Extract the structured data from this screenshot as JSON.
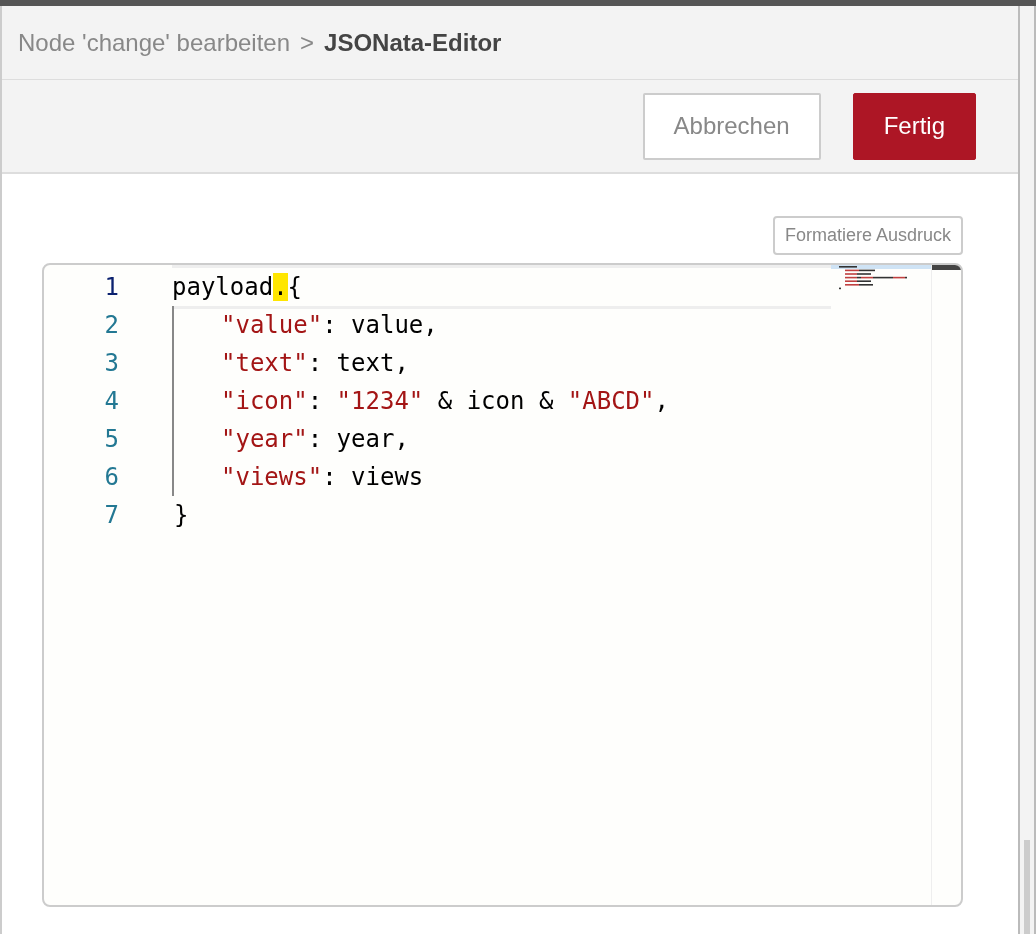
{
  "breadcrumb": {
    "parent": "Node 'change' bearbeiten",
    "separator": ">",
    "current": "JSONata-Editor"
  },
  "buttons": [
    {
      "label": "Abbrechen",
      "kind": "secondary"
    },
    {
      "label": "Fertig",
      "kind": "primary"
    }
  ],
  "format_button": {
    "label": "Formatiere Ausdruck"
  },
  "editor": {
    "lines": [
      {
        "number": "1",
        "active": true,
        "indent": false,
        "tokens": [
          {
            "text": "payload",
            "kind": "plain",
            "highlighted": false
          },
          {
            "text": ".",
            "kind": "plain",
            "highlighted": true
          },
          {
            "text": "{",
            "kind": "plain",
            "highlighted": false
          }
        ]
      },
      {
        "number": "2",
        "active": false,
        "indent": true,
        "tokens": [
          {
            "text": "\"value\"",
            "kind": "string",
            "highlighted": false
          },
          {
            "text": ": value,",
            "kind": "plain",
            "highlighted": false
          }
        ]
      },
      {
        "number": "3",
        "active": false,
        "indent": true,
        "tokens": [
          {
            "text": "\"text\"",
            "kind": "string",
            "highlighted": false
          },
          {
            "text": ": text,",
            "kind": "plain",
            "highlighted": false
          }
        ]
      },
      {
        "number": "4",
        "active": false,
        "indent": true,
        "tokens": [
          {
            "text": "\"icon\"",
            "kind": "string",
            "highlighted": false
          },
          {
            "text": ": ",
            "kind": "plain",
            "highlighted": false
          },
          {
            "text": "\"1234\"",
            "kind": "string",
            "highlighted": false
          },
          {
            "text": " & icon & ",
            "kind": "plain",
            "highlighted": false
          },
          {
            "text": "\"ABCD\"",
            "kind": "string",
            "highlighted": false
          },
          {
            "text": ",",
            "kind": "plain",
            "highlighted": false
          }
        ]
      },
      {
        "number": "5",
        "active": false,
        "indent": true,
        "tokens": [
          {
            "text": "\"year\"",
            "kind": "string",
            "highlighted": false
          },
          {
            "text": ": year,",
            "kind": "plain",
            "highlighted": false
          }
        ]
      },
      {
        "number": "6",
        "active": false,
        "indent": true,
        "tokens": [
          {
            "text": "\"views\"",
            "kind": "string",
            "highlighted": false
          },
          {
            "text": ": views",
            "kind": "plain",
            "highlighted": false
          }
        ]
      },
      {
        "number": "7",
        "active": false,
        "indent": false,
        "tokens": [
          {
            "text": "}",
            "kind": "plain",
            "highlighted": false
          }
        ]
      }
    ]
  }
}
